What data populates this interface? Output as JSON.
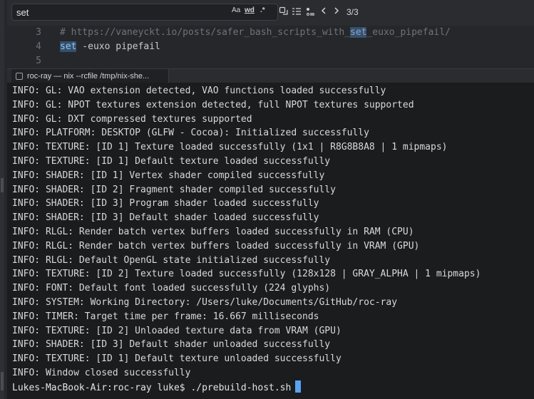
{
  "search": {
    "query": "set",
    "match_case_label": "Aa",
    "whole_word_label": "wd",
    "regex_label": ".*",
    "match_count": "3/3"
  },
  "editor": {
    "lines": [
      {
        "num": "3",
        "pre": "# https://vaneyckt.io/posts/safer_bash_scripts_with_",
        "match": "set",
        "post": "_euxo_pipefail/"
      },
      {
        "num": "4",
        "kw": "set",
        "rest": " -euxo pipefail"
      },
      {
        "num": "5"
      }
    ]
  },
  "terminal_tab": {
    "label": "roc-ray — nix --rcfile /tmp/nix-she..."
  },
  "terminal": {
    "lines": [
      "INFO: GL: VAO extension detected, VAO functions loaded successfully",
      "INFO: GL: NPOT textures extension detected, full NPOT textures supported",
      "INFO: GL: DXT compressed textures supported",
      "INFO: PLATFORM: DESKTOP (GLFW - Cocoa): Initialized successfully",
      "INFO: TEXTURE: [ID 1] Texture loaded successfully (1x1 | R8G8B8A8 | 1 mipmaps)",
      "INFO: TEXTURE: [ID 1] Default texture loaded successfully",
      "INFO: SHADER: [ID 1] Vertex shader compiled successfully",
      "INFO: SHADER: [ID 2] Fragment shader compiled successfully",
      "INFO: SHADER: [ID 3] Program shader loaded successfully",
      "INFO: SHADER: [ID 3] Default shader loaded successfully",
      "INFO: RLGL: Render batch vertex buffers loaded successfully in RAM (CPU)",
      "INFO: RLGL: Render batch vertex buffers loaded successfully in VRAM (GPU)",
      "INFO: RLGL: Default OpenGL state initialized successfully",
      "INFO: TEXTURE: [ID 2] Texture loaded successfully (128x128 | GRAY_ALPHA | 1 mipmaps)",
      "INFO: FONT: Default font loaded successfully (224 glyphs)",
      "INFO: SYSTEM: Working Directory: /Users/luke/Documents/GitHub/roc-ray",
      "INFO: TIMER: Target time per frame: 16.667 milliseconds",
      "INFO: TEXTURE: [ID 2] Unloaded texture data from VRAM (GPU)",
      "INFO: SHADER: [ID 3] Default shader unloaded successfully",
      "INFO: TEXTURE: [ID 1] Default texture unloaded successfully",
      "INFO: Window closed successfully"
    ],
    "prompt": "Lukes-MacBook-Air:roc-ray luke$ ./prebuild-host.sh"
  },
  "colors": {
    "terminal_bg": "#1b1c1e",
    "editor_bg": "#25272b",
    "cursor": "#5aa2f0",
    "match_highlight": "#3a4f6a"
  }
}
